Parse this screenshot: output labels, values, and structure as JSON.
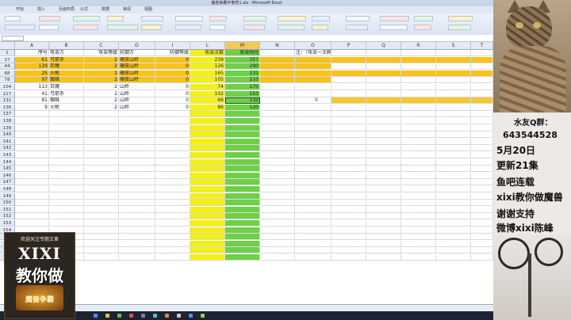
{
  "window": {
    "title": "魔兽争霸平衡性1.xls - Microsoft Excel"
  },
  "ribbon_tabs": [
    "开始",
    "插入",
    "页面布局",
    "公式",
    "数据",
    "审阅",
    "视图"
  ],
  "columns": [
    "A",
    "B",
    "C",
    "G",
    "I",
    "L",
    "M",
    "N",
    "O",
    "P",
    "Q",
    "R",
    "S",
    "T"
  ],
  "header_row": {
    "row": "1",
    "cells": [
      "序号",
      "攻击方",
      "攻击等级",
      "防御方",
      "防御等级",
      "攻击次数",
      "攻击时间",
      "",
      "注：（攻击一次耗费12）*防御属性*防御力",
      "",
      "",
      "",
      "",
      ""
    ]
  },
  "data_rows": [
    {
      "row": "27",
      "cells": [
        "61",
        "弓箭手",
        "2",
        "硬皮山岭",
        "0",
        "239",
        "357"
      ]
    },
    {
      "row": "44",
      "cells": [
        "129",
        "巨魔",
        "2",
        "硬皮山岭",
        "0",
        "126",
        "290"
      ]
    },
    {
      "row": "68",
      "cells": [
        "25",
        "火枪",
        "2",
        "硬皮山岭",
        "0",
        "165",
        "231"
      ]
    },
    {
      "row": "78",
      "cells": [
        "97",
        "蜘蛛",
        "2",
        "硬皮山岭",
        "0",
        "105",
        "210"
      ]
    },
    {
      "row": "104",
      "cells": [
        "113",
        "巨魔",
        "2",
        "山岭",
        "0",
        "74",
        "170"
      ]
    },
    {
      "row": "117",
      "cells": [
        "41",
        "弓箭手",
        "2",
        "山岭",
        "0",
        "102",
        "153"
      ]
    },
    {
      "row": "131",
      "cells": [
        "81",
        "蜘蛛",
        "2",
        "山岭",
        "0",
        "66",
        "132"
      ]
    },
    {
      "row": "136",
      "cells": [
        "9",
        "火枪",
        "2",
        "山岭",
        "0",
        "86",
        "120"
      ]
    }
  ],
  "empty_rows": [
    "137",
    "138",
    "139",
    "140",
    "141",
    "142",
    "143",
    "144",
    "145",
    "146",
    "147",
    "148",
    "149",
    "150",
    "151",
    "152",
    "153",
    "154",
    "155",
    "156",
    "157",
    "158"
  ],
  "active_cell": {
    "value": "0"
  },
  "promo": {
    "caption": "欢迎关注专题文章",
    "brand": "XIXI",
    "headline": "教你做",
    "badge": "魔兽争霸"
  },
  "side_panel": {
    "qq_label": "水友Q群：",
    "qq_number": "643544528",
    "lines": [
      "5月20日",
      "更新21集",
      "鱼吧连载",
      "xixi教你做魔兽",
      "谢谢支持",
      "微博xixi陈峰"
    ]
  },
  "colors": {
    "highlight_orange": "#f7c21a",
    "attack_count_col": "#f4f016",
    "attack_time_col": "#6fd048"
  }
}
